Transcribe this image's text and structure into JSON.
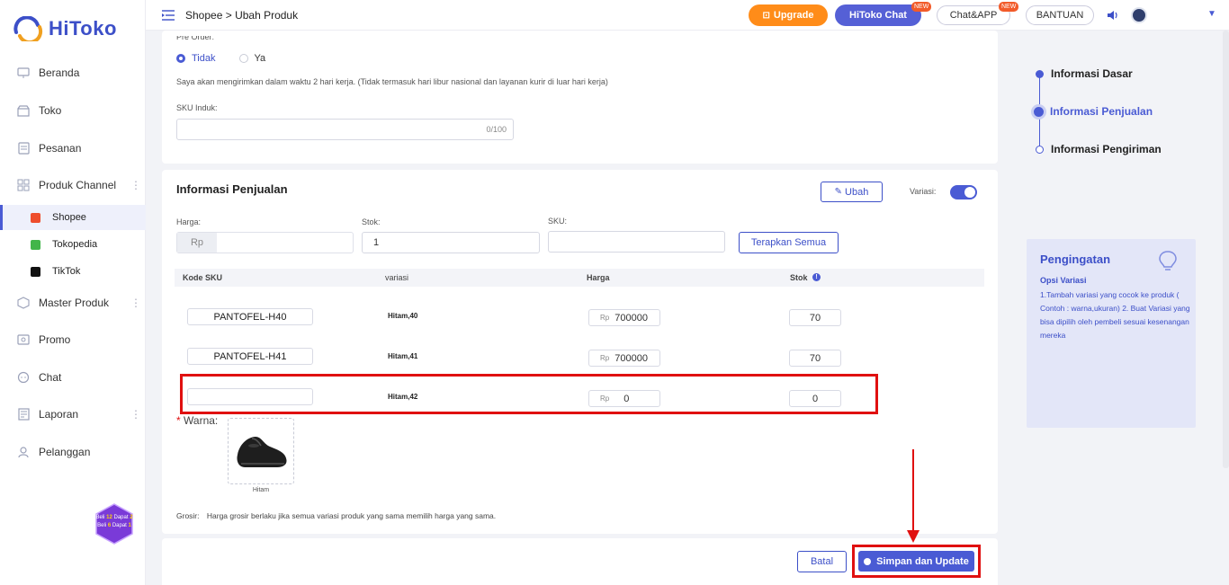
{
  "app": {
    "logo_text": "HiToko"
  },
  "colors": {
    "accent": "#4a5bd4",
    "upgrade": "#ff8c19",
    "highlight": "#e01010"
  },
  "sidebar": {
    "items": [
      {
        "label": "Beranda",
        "icon": "monitor-icon"
      },
      {
        "label": "Toko",
        "icon": "store-icon"
      },
      {
        "label": "Pesanan",
        "icon": "orders-icon"
      },
      {
        "label": "Produk Channel",
        "icon": "grid-icon"
      },
      {
        "label": "Master Produk",
        "icon": "box-icon"
      },
      {
        "label": "Promo",
        "icon": "promo-icon"
      },
      {
        "label": "Chat",
        "icon": "chat-icon"
      },
      {
        "label": "Laporan",
        "icon": "report-icon"
      },
      {
        "label": "Pelanggan",
        "icon": "customers-icon"
      }
    ],
    "sub_items": [
      {
        "label": "Shopee",
        "color": "#ee4d2d"
      },
      {
        "label": "Tokopedia",
        "color": "#42b549"
      },
      {
        "label": "TikTok",
        "color": "#111111"
      }
    ],
    "promo_badge": {
      "line1_a": "Beli",
      "line1_b": "12",
      "line1_c": "Dapat",
      "line1_d": "2",
      "line2_a": "Beli",
      "line2_b": "6",
      "line2_c": "Dapat",
      "line2_d": "1"
    }
  },
  "topbar": {
    "breadcrumb_parent": "Shopee",
    "breadcrumb_sep": " > ",
    "breadcrumb_current": "Ubah Produk",
    "upgrade": "Upgrade",
    "hitoko_chat": "HiToko Chat",
    "chat_app": "Chat&APP",
    "bantuan": "BANTUAN",
    "new_badge": "NEW"
  },
  "preorder": {
    "label": "Pre Order:",
    "opt_no": "Tidak",
    "opt_yes": "Ya",
    "note": "Saya akan mengirimkan dalam waktu 2 hari kerja. (Tidak termasuk hari libur nasional dan layanan kurir di luar hari kerja)",
    "sku_induk_label": "SKU Induk:",
    "sku_induk_counter": "0/100"
  },
  "sales": {
    "title": "Informasi Penjualan",
    "ubah": "Ubah",
    "variasi_label": "Variasi:",
    "harga_label": "Harga:",
    "harga_prefix": "Rp",
    "stok_label": "Stok:",
    "stok_value": "1",
    "sku_label": "SKU:",
    "terapkan": "Terapkan Semua",
    "table_headers": {
      "kode": "Kode SKU",
      "variasi": "variasi",
      "harga": "Harga",
      "stok": "Stok"
    },
    "rows": [
      {
        "kode": "PANTOFEL-H40",
        "variasi": "Hitam,40",
        "rp": "Rp",
        "harga": "700000",
        "stok": "70"
      },
      {
        "kode": "PANTOFEL-H41",
        "variasi": "Hitam,41",
        "rp": "Rp",
        "harga": "700000",
        "stok": "70"
      },
      {
        "kode": "",
        "variasi": "Hitam,42",
        "rp": "Rp",
        "harga": "0",
        "stok": "0"
      }
    ],
    "warna_required": "*",
    "warna_label": "Warna:",
    "warna_caption": "Hitam",
    "grosir_label": "Grosir:",
    "grosir_note": "Harga grosir berlaku jika semua variasi produk yang sama memilih harga yang sama."
  },
  "footer": {
    "batal": "Batal",
    "simpan": "Simpan dan Update"
  },
  "steps": [
    {
      "label": "Informasi Dasar",
      "active": false
    },
    {
      "label": "Informasi Penjualan",
      "active": true
    },
    {
      "label": "Informasi Pengiriman",
      "active": false
    }
  ],
  "reminder": {
    "title": "Pengingatan",
    "subtitle": "Opsi Variasi",
    "body": "1.Tambah variasi yang cocok ke produk ( Contoh : warna,ukuran) 2. Buat Variasi yang bisa dipilih oleh pembeli sesuai kesenangan mereka"
  }
}
